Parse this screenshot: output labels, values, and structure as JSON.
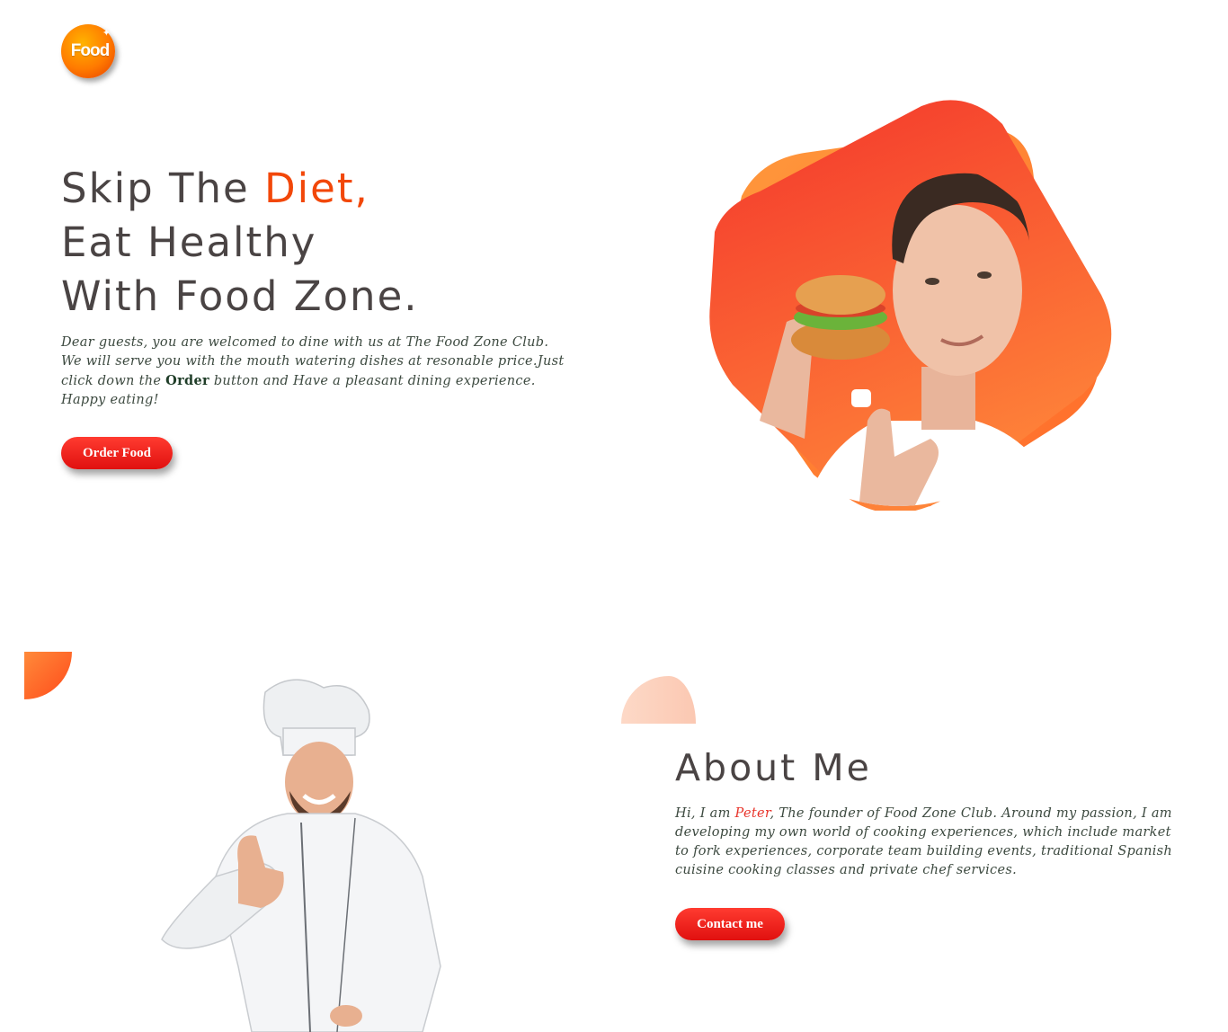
{
  "logo": {
    "text": "Food",
    "star": "✦",
    "icon": "food-logo-icon"
  },
  "hero": {
    "title_part1": "Skip The ",
    "title_accent": "Diet,",
    "title_line2": "Eat Healthy",
    "title_line3": "With Food Zone.",
    "desc_before": "Dear guests, you are welcomed to dine with us at The Food Zone Club. We will serve you with the mouth watering dishes at resonable price.Just click down the ",
    "desc_bold": "Order",
    "desc_after": " button and Have a pleasant dining experience. Happy eating!",
    "button_label": "Order Food"
  },
  "about": {
    "title": "About Me",
    "desc_before": "Hi, I am ",
    "desc_name": "Peter",
    "desc_after": ", The founder of Food Zone Club. Around my passion, I am developing my own world of cooking experiences, which include market to fork experiences, corporate team building events, traditional Spanish cuisine cooking classes and private chef services.",
    "button_label": "Contact me"
  },
  "colors": {
    "accent": "#f24709",
    "button": "#e0100f",
    "text": "#4a4444",
    "name": "#e8332a"
  }
}
